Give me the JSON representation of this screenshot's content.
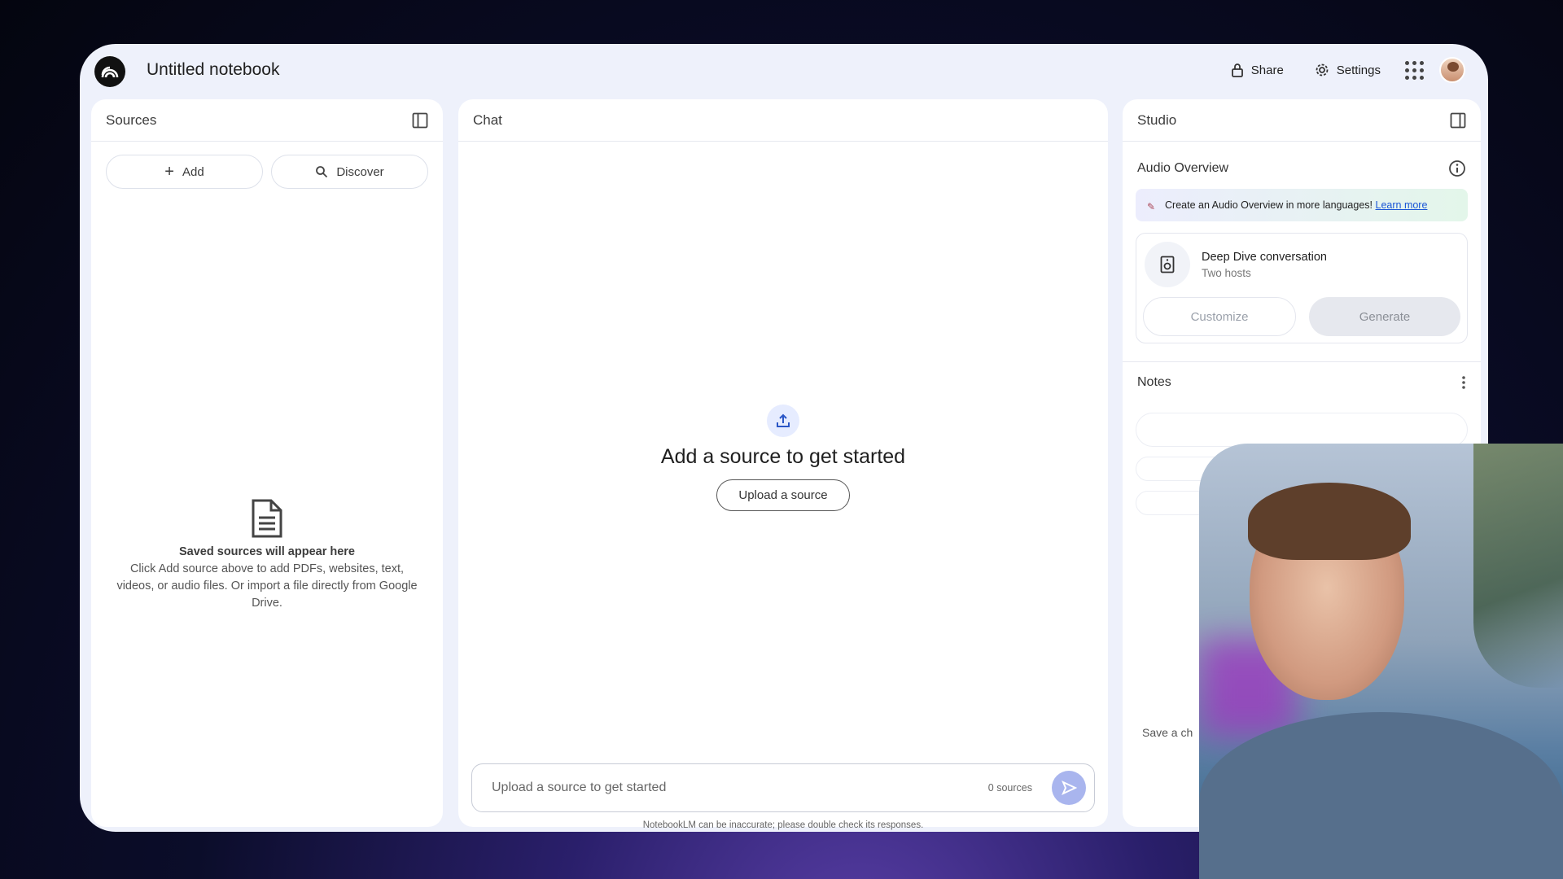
{
  "header": {
    "title": "Untitled notebook",
    "share_label": "Share",
    "settings_label": "Settings"
  },
  "sources": {
    "title": "Sources",
    "add_label": "Add",
    "discover_label": "Discover",
    "empty_title": "Saved sources will appear here",
    "empty_body": "Click Add source above to add PDFs, websites, text, videos, or audio files. Or import a file directly from Google Drive."
  },
  "chat": {
    "title": "Chat",
    "headline": "Add a source to get started",
    "upload_button": "Upload a source",
    "input_placeholder": "Upload a source to get started",
    "source_count": "0 sources",
    "disclaimer": "NotebookLM can be inaccurate; please double check its responses."
  },
  "studio": {
    "title": "Studio",
    "audio_overview_title": "Audio Overview",
    "promo_text": "Create an Audio Overview in more languages!",
    "promo_link": "Learn more",
    "deep_dive_title": "Deep Dive conversation",
    "deep_dive_subtitle": "Two hosts",
    "customize_label": "Customize",
    "generate_label": "Generate",
    "notes_title": "Notes",
    "notes_hint": "Save a ch"
  },
  "colors": {
    "accent": "#a9b5ee",
    "panel_bg": "#eef1fb",
    "link": "#1a56d6"
  },
  "icons": [
    "notebooklm-logo-icon",
    "lock-icon",
    "gear-icon",
    "apps-grid-icon",
    "sidebar-toggle-icon",
    "plus-icon",
    "discover-search-icon",
    "document-icon",
    "upload-icon",
    "send-icon",
    "info-icon",
    "sparkle-icon",
    "speaker-icon",
    "more-vert-icon"
  ]
}
